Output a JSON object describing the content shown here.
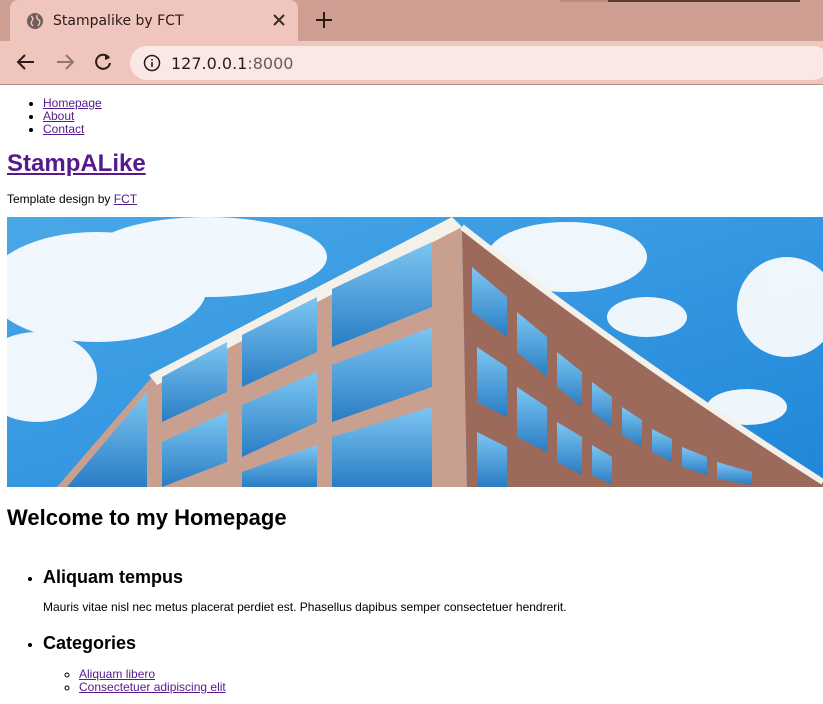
{
  "browser": {
    "tab": {
      "title": "Stampalike by FCT",
      "favicon": "globe-icon",
      "close_icon": "close-icon"
    },
    "new_tab_icon": "plus-icon",
    "nav": {
      "back_icon": "arrow-left-icon",
      "forward_icon": "arrow-right-icon",
      "reload_icon": "reload-icon"
    },
    "address": {
      "info_icon": "info-icon",
      "host": "127.0.0.1",
      "port": ":8000"
    },
    "colors": {
      "frame": "#cf9e92",
      "tab_active": "#f0c5bd",
      "omnibox": "#fae8e5"
    }
  },
  "page": {
    "nav": [
      "Homepage",
      "About",
      "Contact"
    ],
    "site_title": "StampALike",
    "credit_prefix": "Template design by ",
    "credit_link": "FCT",
    "welcome": "Welcome to my Homepage",
    "sidebar": {
      "section1_title": "Aliquam tempus",
      "section1_text": "Mauris vitae nisl nec metus placerat perdiet est. Phasellus dapibus semper consectetuer hendrerit.",
      "section2_title": "Categories",
      "categories": [
        "Aliquam libero",
        "Consectetuer adipiscing elit"
      ]
    },
    "link_color": "#551a8b"
  }
}
